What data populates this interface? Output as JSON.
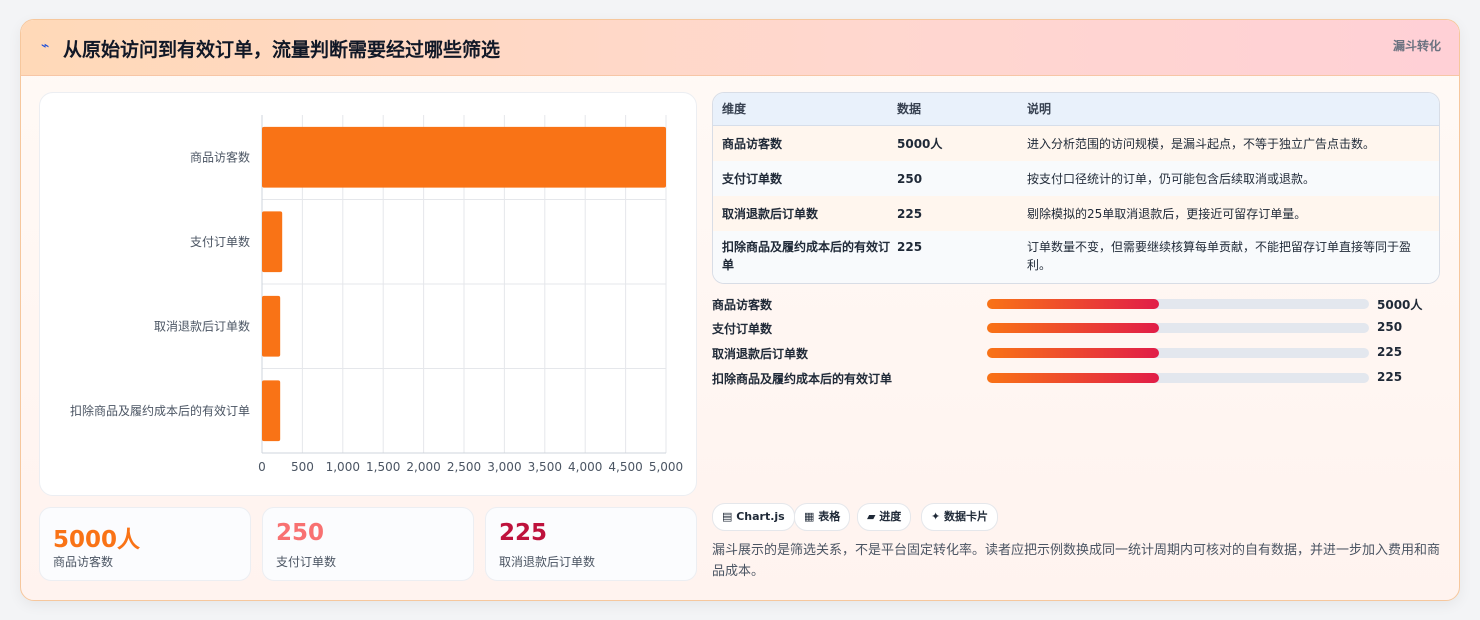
{
  "header": {
    "icon": "lightning-icon",
    "title": "从原始访问到有效订单，流量判断需要经过哪些筛选",
    "badge": "漏斗转化"
  },
  "chart_data": {
    "type": "bar",
    "orientation": "horizontal",
    "categories": [
      "商品访客数",
      "支付订单数",
      "取消退款后订单数",
      "扣除商品及履约成本后的有效订单"
    ],
    "values": [
      5000,
      250,
      225,
      225
    ],
    "xlim": [
      0,
      5000
    ],
    "xticks": [
      "0",
      "500",
      "1,000",
      "1,500",
      "2,000",
      "2,500",
      "3,000",
      "3,500",
      "4,000",
      "4,500",
      "5,000"
    ],
    "bar_color": "#f97316",
    "grid": true
  },
  "stats": [
    {
      "value": "5000人",
      "label": "商品访客数",
      "color": "#f97316"
    },
    {
      "value": "250",
      "label": "支付订单数",
      "color": "#f87171"
    },
    {
      "value": "225",
      "label": "取消退款后订单数",
      "color": "#be123c"
    }
  ],
  "table": {
    "headers": [
      "维度",
      "数据",
      "说明"
    ],
    "rows": [
      {
        "dim": "商品访客数",
        "value": "5000人",
        "desc": "进入分析范围的访问规模，是漏斗起点，不等于独立广告点击数。"
      },
      {
        "dim": "支付订单数",
        "value": "250",
        "desc": "按支付口径统计的订单，仍可能包含后续取消或退款。"
      },
      {
        "dim": "取消退款后订单数",
        "value": "225",
        "desc": "剔除模拟的25单取消退款后，更接近可留存订单量。"
      },
      {
        "dim": "扣除商品及履约成本后的有效订单",
        "value": "225",
        "desc": "订单数量不变，但需要继续核算每单贡献，不能把留存订单直接等同于盈利。"
      }
    ]
  },
  "progress": [
    {
      "label": "商品访客数",
      "value": "5000人",
      "fraction": 0.45
    },
    {
      "label": "支付订单数",
      "value": "250",
      "fraction": 0.45
    },
    {
      "label": "取消退款后订单数",
      "value": "225",
      "fraction": 0.45
    },
    {
      "label": "扣除商品及履约成本后的有效订单",
      "value": "225",
      "fraction": 0.45
    }
  ],
  "chips": [
    {
      "icon": "chart-icon",
      "label": "▤ Chart.js"
    },
    {
      "icon": "table-icon",
      "label": "▦ 表格"
    },
    {
      "icon": "progress-icon",
      "label": "▰ 进度"
    },
    {
      "icon": "sparkle-icon",
      "label": "✦ 数据卡片"
    }
  ],
  "note": "漏斗展示的是筛选关系，不是平台固定转化率。读者应把示例数换成同一统计周期内可核对的自有数据，并进一步加入费用和商品成本。"
}
